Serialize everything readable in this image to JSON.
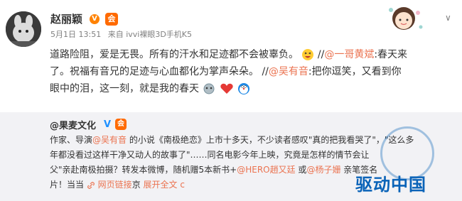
{
  "post": {
    "username": "赵丽颖",
    "vip_badge": "V",
    "member_badge": "会",
    "date": "5月1日 13:51",
    "source_prefix": "来自",
    "source": "ivvi裸眼3D手机K5",
    "chevron": "∨",
    "lines": {
      "l1_text": "道路险阻，爱是无畏。所有的汗水和足迹都不会被辜负。",
      "l1_sep": "//",
      "l1_mention": "@一哥黄斌",
      "l1_tail": ":春天来",
      "l2_text": "了。祝福有音兄的足迹与心血都化为掌声朵朵。 //",
      "l2_mention": "@吴有音",
      "l2_tail": ":把你逗笑，又看到你",
      "l3_text": "眼中的泪，这一刻，就是我的春天"
    }
  },
  "repost": {
    "author": "@果麦文化",
    "v_badge": "V",
    "member_badge": "会",
    "lines": {
      "r1a": "作家、导演",
      "r1_mention": "@吴有音",
      "r1b": " 的小说《南极绝恋》上市十多天，不少读者感叹\"真的把我看哭了\"，\"这么多",
      "r2": "年都没看过这样干净又动人的故事了\"……同名电影今年上映，究竟是怎样的情节会让",
      "r3a": "父\"亲赴南极拍摄？转发本微博，随机赠5本新书+",
      "r3_mention1": "@HERO趙又廷",
      "r3_or": " 或",
      "r3_mention2": "@杨子姗",
      "r3b": " 亲笔签名",
      "r4a": "片！当当",
      "r4_link": "网页链接",
      "r4b": "京",
      "r4_more": "展开全文",
      "r4_chev": "c"
    }
  },
  "watermark": {
    "text": "驱动中国"
  }
}
